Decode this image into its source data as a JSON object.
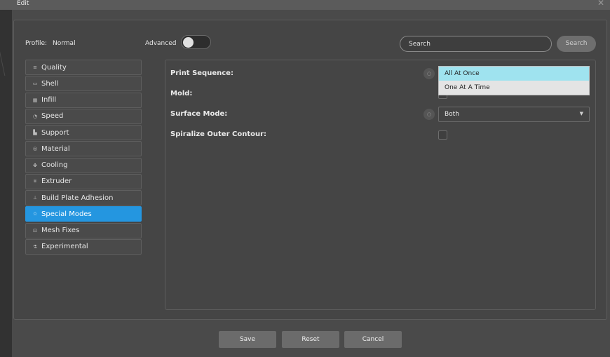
{
  "window": {
    "title": "Edit"
  },
  "header": {
    "profile_label": "Profile:",
    "profile_value": "Normal",
    "advanced_label": "Advanced",
    "advanced_on": false,
    "search_placeholder": "Search",
    "search_button": "Search"
  },
  "sidebar": {
    "items": [
      {
        "label": "Quality",
        "icon": "quality-icon",
        "glyph": "≡"
      },
      {
        "label": "Shell",
        "icon": "shell-icon",
        "glyph": "▭"
      },
      {
        "label": "Infill",
        "icon": "infill-icon",
        "glyph": "▦"
      },
      {
        "label": "Speed",
        "icon": "speed-icon",
        "glyph": "◔"
      },
      {
        "label": "Support",
        "icon": "support-icon",
        "glyph": "▙"
      },
      {
        "label": "Material",
        "icon": "material-icon",
        "glyph": "◎"
      },
      {
        "label": "Cooling",
        "icon": "fan-icon",
        "glyph": "✤"
      },
      {
        "label": "Extruder",
        "icon": "extruder-icon",
        "glyph": "⩸"
      },
      {
        "label": "Build Plate Adhesion",
        "icon": "build-plate-icon",
        "glyph": "⊥"
      },
      {
        "label": "Special Modes",
        "icon": "star-icon",
        "glyph": "☆",
        "active": true
      },
      {
        "label": "Mesh Fixes",
        "icon": "mesh-icon",
        "glyph": "⊡"
      },
      {
        "label": "Experimental",
        "icon": "flask-icon",
        "glyph": "⚗"
      }
    ]
  },
  "settings": {
    "print_sequence": {
      "label": "Print Sequence:",
      "value": "All At Once"
    },
    "mold": {
      "label": "Mold:",
      "checked": false
    },
    "surface_mode": {
      "label": "Surface Mode:",
      "value": "Both"
    },
    "spiralize": {
      "label": "Spiralize Outer Contour:",
      "checked": false
    }
  },
  "dropdown": {
    "options": [
      "All At Once",
      "One At A Time"
    ],
    "selected": "All At Once"
  },
  "footer": {
    "save": "Save",
    "reset": "Reset",
    "cancel": "Cancel"
  },
  "colors": {
    "accent": "#2496e0",
    "dropdown_highlight": "#9fe3ef",
    "dialog_bg": "#4a4a4a"
  }
}
